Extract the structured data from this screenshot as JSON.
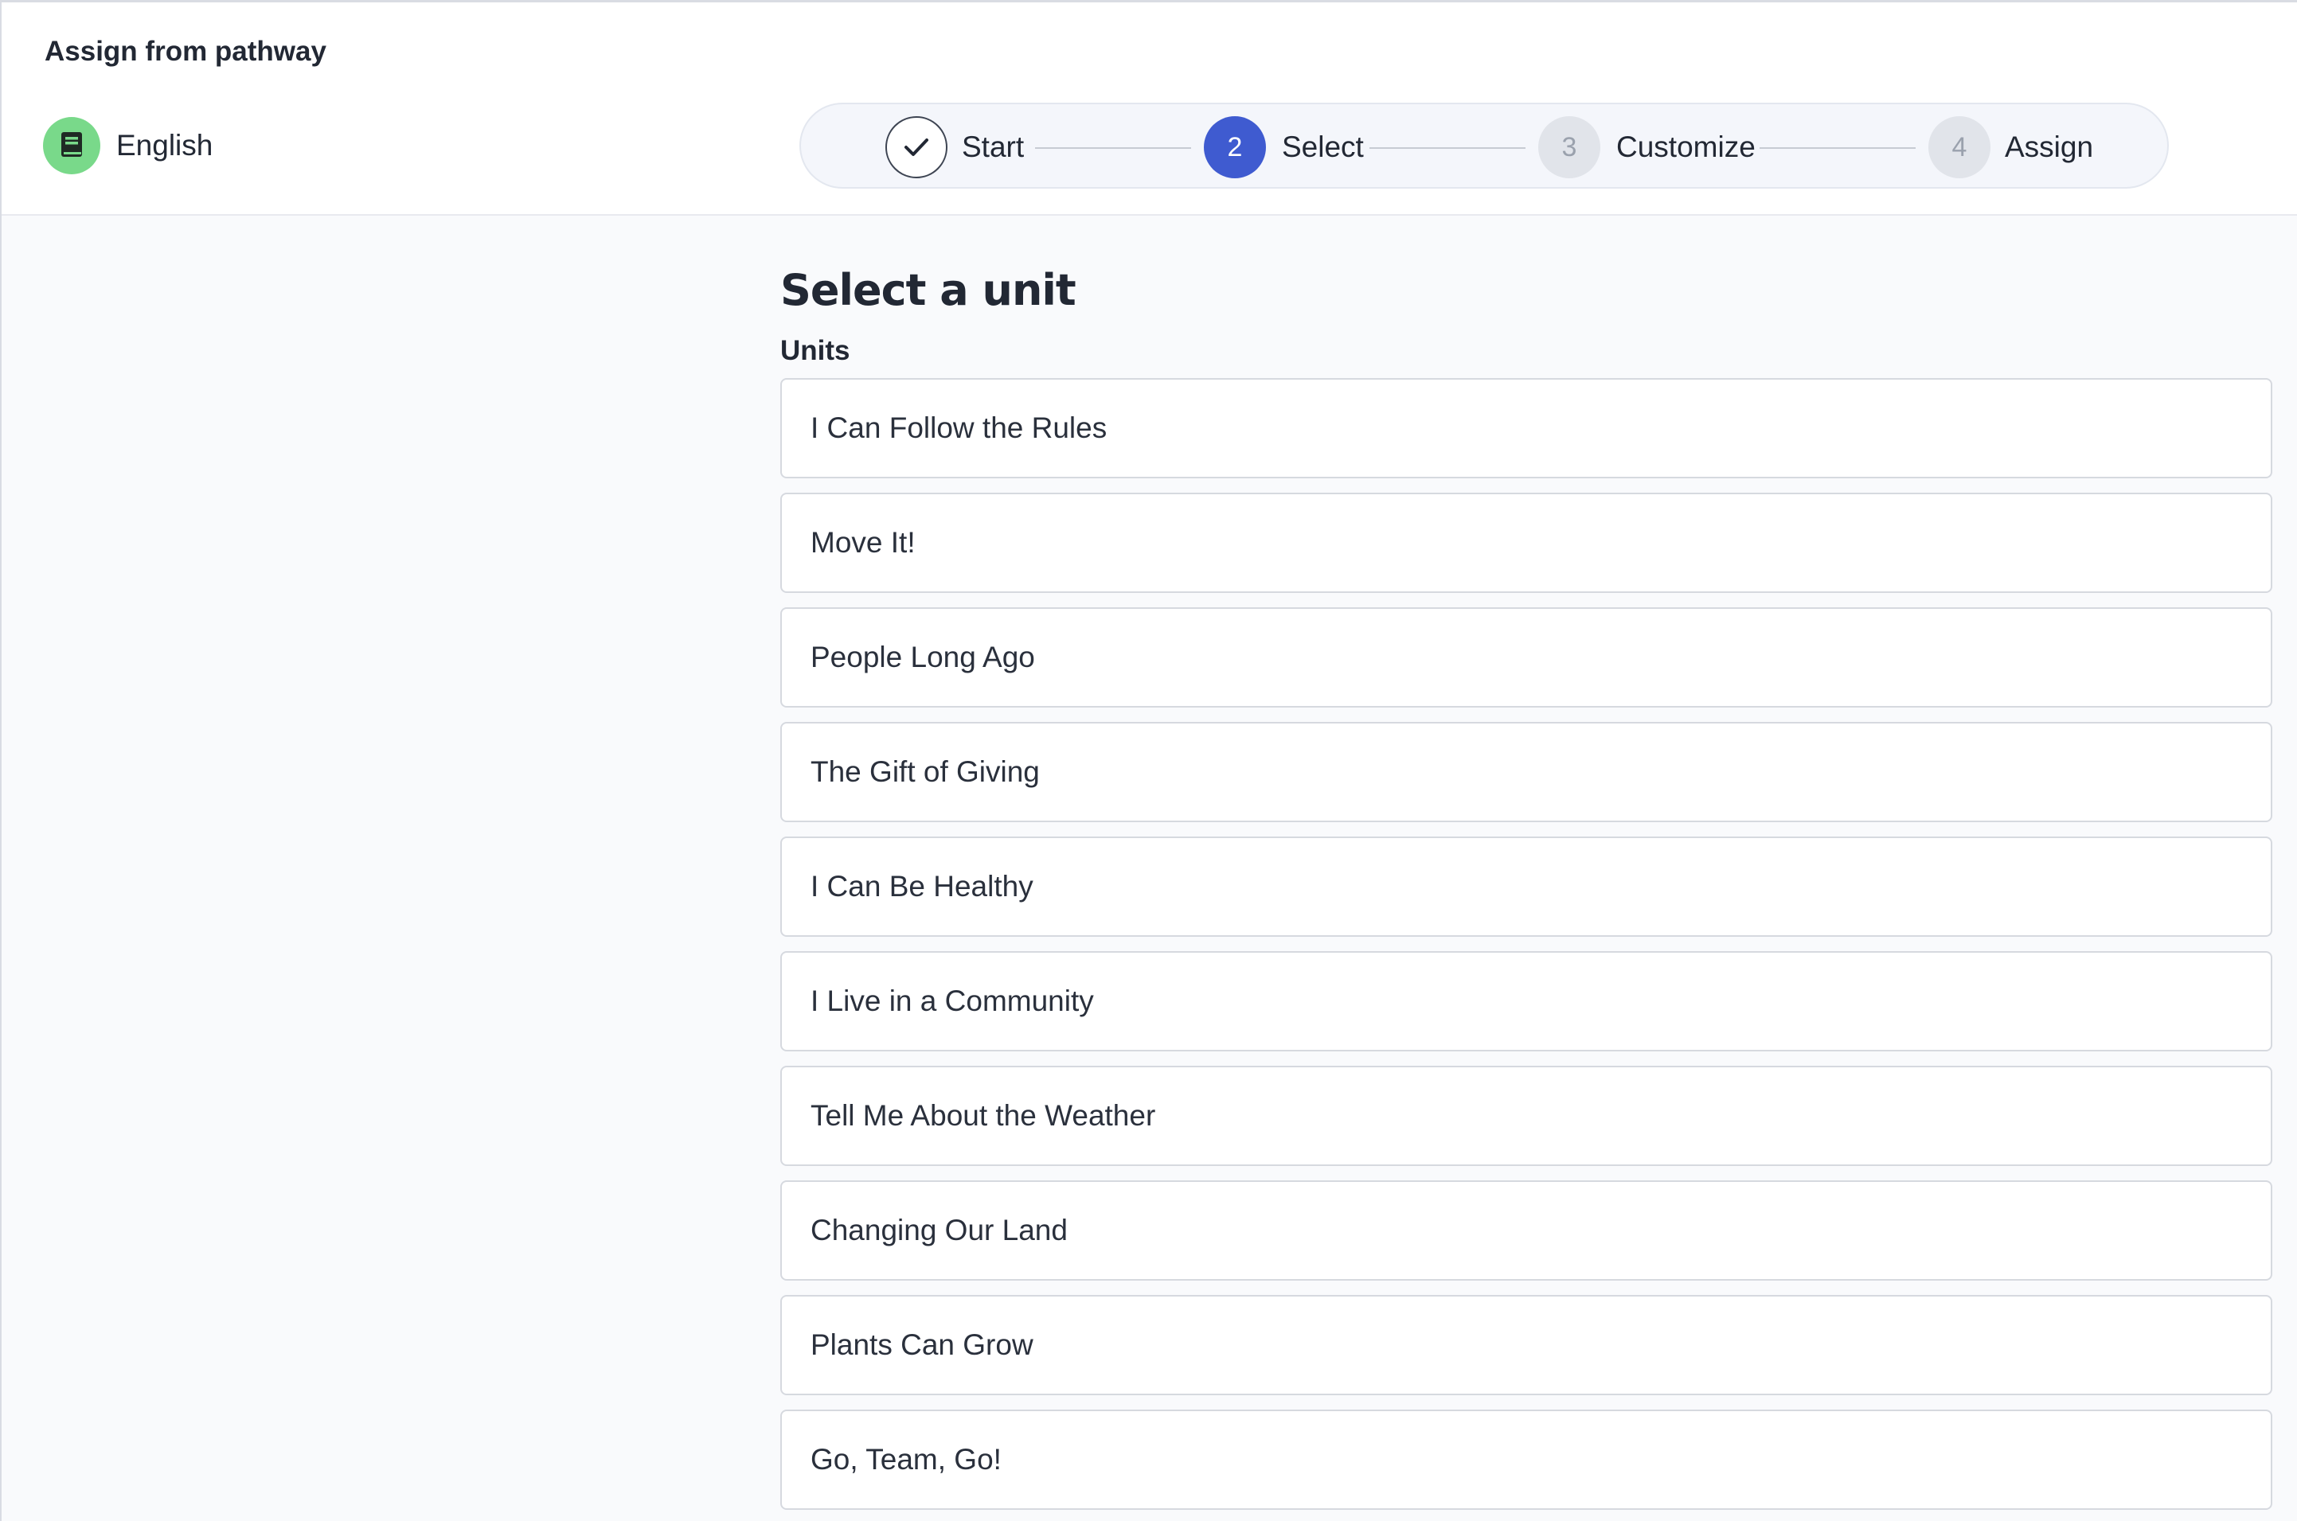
{
  "header": {
    "title": "Assign from pathway",
    "subject": {
      "label": "English",
      "icon": "book-icon",
      "color": "#79d98a"
    }
  },
  "stepper": {
    "steps": [
      {
        "label": "Start",
        "number": "",
        "state": "completed"
      },
      {
        "label": "Select",
        "number": "2",
        "state": "active"
      },
      {
        "label": "Customize",
        "number": "3",
        "state": "pending"
      },
      {
        "label": "Assign",
        "number": "4",
        "state": "pending"
      }
    ],
    "accent_color": "#3f5bd0"
  },
  "main": {
    "heading": "Select a unit",
    "list_label": "Units",
    "units": [
      "I Can Follow the Rules",
      "Move It!",
      "People Long Ago",
      "The Gift of Giving",
      "I Can Be Healthy",
      "I Live in a Community",
      "Tell Me About the Weather",
      "Changing Our Land",
      "Plants Can Grow",
      "Go, Team, Go!"
    ]
  }
}
